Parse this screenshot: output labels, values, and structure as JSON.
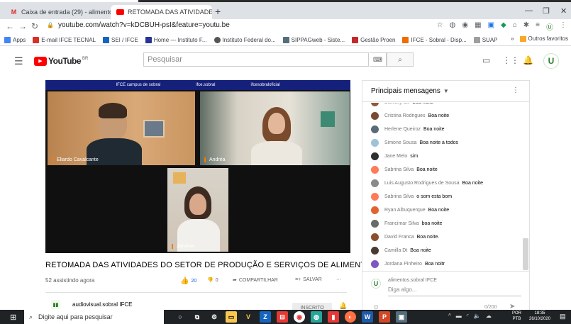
{
  "browser": {
    "tabs": [
      {
        "label": "Caixa de entrada (29) - alimento",
        "favicon_color": "#d93025"
      },
      {
        "label": "RETOMADA DAS ATIVIDADE",
        "favicon_color": "#ff0000"
      }
    ],
    "url": "youtube.com/watch?v=kDCBUH-psI&feature=youtu.be",
    "bookmarks": [
      {
        "label": "Apps"
      },
      {
        "label": "E-mail IFCE TECNAL"
      },
      {
        "label": "SEI / IFCE"
      },
      {
        "label": "Home — Instituto F..."
      },
      {
        "label": "Instituto Federal do..."
      },
      {
        "label": "SIPPAGweb - Siste..."
      },
      {
        "label": "Gestão Proen"
      },
      {
        "label": "IFCE - Sobral - Disp..."
      },
      {
        "label": "SUAP"
      }
    ],
    "other_bookmarks": "Outros favoritos"
  },
  "youtube": {
    "logo_text": "YouTube",
    "region": "BR",
    "search_placeholder": "Pesquisar"
  },
  "video": {
    "banner": [
      "IFCE campus de sobral",
      "ifce.sobral",
      "ifcesobraloficial"
    ],
    "participants": [
      "Eliardo Cavalcante",
      "Andréa",
      "Janaina"
    ],
    "title": "RETOMADA DAS ATIVIDADES DO SETOR DE PRODUÇÃO E SERVIÇOS DE ALIMENTOS",
    "views": "52 assistindo agora",
    "likes": "20",
    "dislikes": "0",
    "share_label": "COMPARTILHAR",
    "save_label": "SALVAR",
    "channel_name": "audiovisual.sobral IFCE",
    "subscribe_label": "INSCRITO"
  },
  "chat": {
    "header": "Principais mensagens",
    "messages": [
      {
        "author": "Danielly Gil",
        "text": "Boa noite",
        "color": "#8d5b3d"
      },
      {
        "author": "Cristina Rodrigues",
        "text": "Boa noite",
        "color": "#7b4a32"
      },
      {
        "author": "Herlene Queiroz",
        "text": "Boa noite",
        "color": "#5a6b78"
      },
      {
        "author": "Simone Sousa",
        "text": "Boa noite a todos",
        "color": "#9ec3d6"
      },
      {
        "author": "Jane Melo",
        "text": "sim",
        "color": "#2f2f2f"
      },
      {
        "author": "Sabrina Silva",
        "text": "Boa noite",
        "color": "#ff7a59"
      },
      {
        "author": "Luis Augusto Rodrigues de Sousa",
        "text": "Boa noite",
        "color": "#8a8a8a"
      },
      {
        "author": "Sabrina Silva",
        "text": "o som esta bom",
        "color": "#ff7a59"
      },
      {
        "author": "Ryan Albuquerque",
        "text": "Boa noite",
        "color": "#e2632f"
      },
      {
        "author": "Francimar Silva",
        "text": "boa noite",
        "color": "#6a6a6a"
      },
      {
        "author": "David Franca",
        "text": "Boa noite.",
        "color": "#8a4f2d"
      },
      {
        "author": "Camilla Dt",
        "text": "Boa noite",
        "color": "#4a3a30"
      },
      {
        "author": "Jordana Pinheiro",
        "text": "Boa noitr",
        "color": "#7e57c2"
      }
    ],
    "composer_name": "alimentos.sobral IFCE",
    "composer_placeholder": "Diga algo...",
    "char_count": "0/200"
  },
  "taskbar": {
    "search_placeholder": "Digite aqui para pesquisar",
    "lang": "POR",
    "lang_sub": "PTB",
    "time": "18:35",
    "date": "26/10/2020"
  }
}
